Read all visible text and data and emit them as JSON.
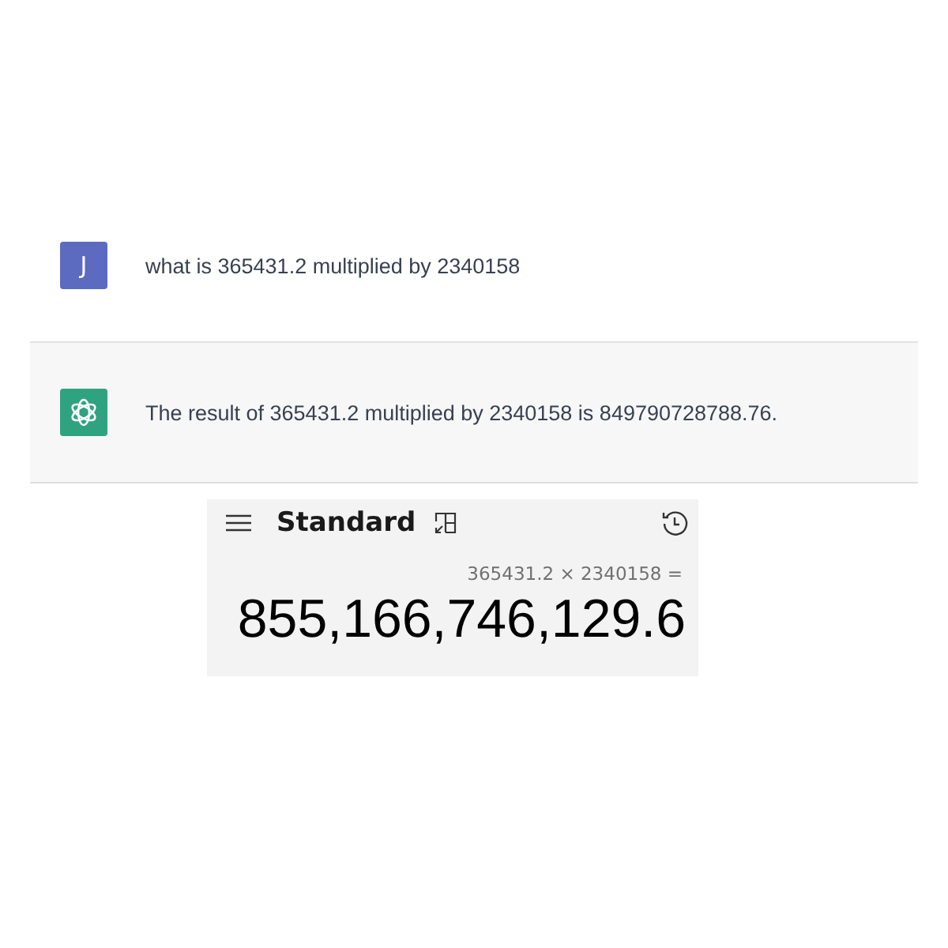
{
  "messages": [
    {
      "kind": "user",
      "avatar": "J",
      "text": "what is 365431.2 multiplied by 2340158"
    },
    {
      "kind": "assistant",
      "text": "The result of 365431.2 multiplied by 2340158 is 849790728788.76."
    }
  ],
  "calculator": {
    "mode": "Standard",
    "expression": "365431.2 × 2340158 =",
    "display": "855,166,746,129.6"
  }
}
